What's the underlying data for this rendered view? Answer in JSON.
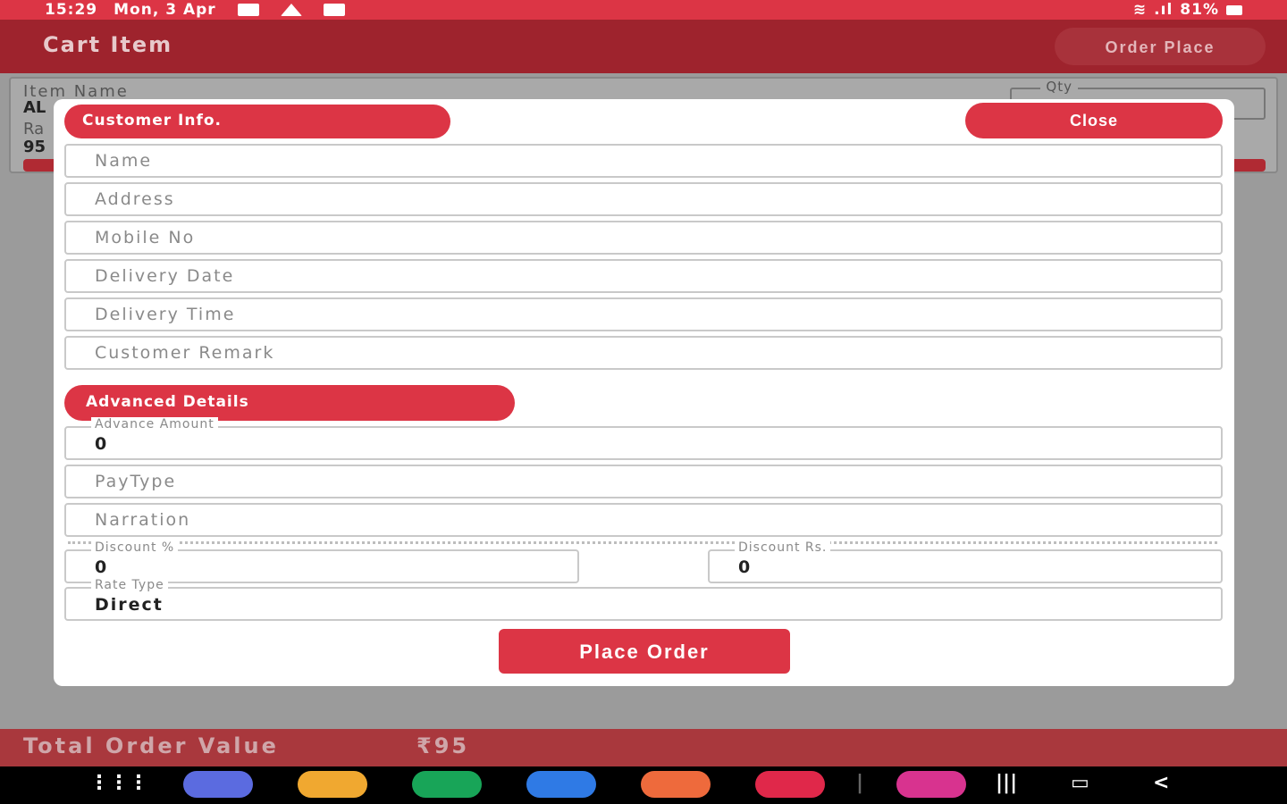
{
  "status_bar": {
    "time": "15:29",
    "date": "Mon, 3 Apr",
    "battery": "81%"
  },
  "app_bar": {
    "title": "Cart Item",
    "order_place_label": "Order Place"
  },
  "item_card": {
    "item_name_label": "Item Name",
    "item_name_value": "AL",
    "rate_label": "Ra",
    "rate_value": "95",
    "qty_label": "Qty"
  },
  "modal": {
    "customer_info_label": "Customer Info.",
    "close_label": "Close",
    "name_placeholder": "Name",
    "address_placeholder": "Address",
    "mobile_placeholder": "Mobile No",
    "delivery_date_placeholder": "Delivery Date",
    "delivery_time_placeholder": "Delivery Time",
    "remark_placeholder": "Customer Remark",
    "advanced_label": "Advanced Details",
    "advance_amount_label": "Advance Amount",
    "advance_amount_value": "0",
    "pay_type_placeholder": "PayType",
    "narration_placeholder": "Narration",
    "discount_pct_label": "Discount %",
    "discount_pct_value": "0",
    "discount_rs_label": "Discount Rs.",
    "discount_rs_value": "0",
    "rate_type_label": "Rate Type",
    "rate_type_value": "Direct",
    "place_order_label": "Place Order"
  },
  "total_bar": {
    "label": "Total Order Value",
    "value": "₹95"
  },
  "nav_bar": {
    "apps": [
      {
        "name": "samsung-internet-icon",
        "color": "#5b6be0"
      },
      {
        "name": "my-files-icon",
        "color": "#f0a830"
      },
      {
        "name": "phone-icon",
        "color": "#18a558"
      },
      {
        "name": "messages-icon",
        "color": "#2f7ae5"
      },
      {
        "name": "contacts-icon",
        "color": "#ee6a3c"
      },
      {
        "name": "youtube-icon",
        "color": "#e0284a"
      },
      {
        "name": "bixby-icon",
        "color": "#d8338f"
      }
    ]
  }
}
